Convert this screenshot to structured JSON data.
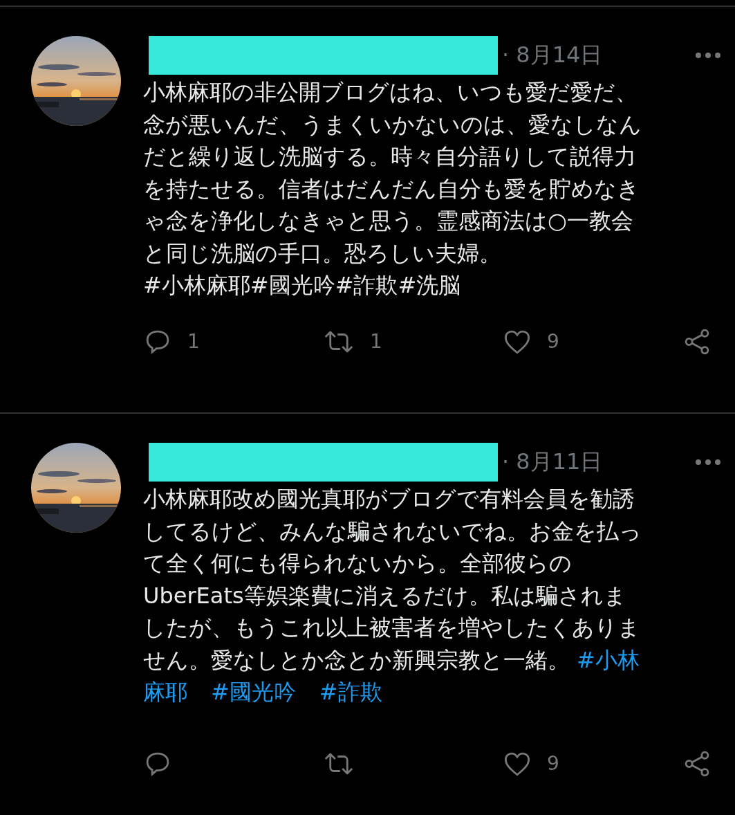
{
  "tweets": [
    {
      "date": "· 8月14日",
      "lines": [
        [
          {
            "kind": "text",
            "text": "小林麻耶の非公開ブログはね、いつも愛だ愛だ、"
          }
        ],
        [
          {
            "kind": "text",
            "text": "念が悪いんだ、うまくいかないのは、愛なしなん"
          }
        ],
        [
          {
            "kind": "text",
            "text": "だと繰り返し洗脳する。時々自分語りして説得力"
          }
        ],
        [
          {
            "kind": "text",
            "text": "を持たせる。信者はだんだん自分も愛を貯めなき"
          }
        ],
        [
          {
            "kind": "text",
            "text": "ゃ念を浄化しなきゃと思う。霊感商法は○一教会"
          }
        ],
        [
          {
            "kind": "text",
            "text": "と同じ洗脳の手口。恐ろしい夫婦。"
          }
        ],
        [
          {
            "kind": "text",
            "text": "#小林麻耶#國光吟#詐欺#洗脳"
          }
        ]
      ],
      "replies": "1",
      "retweets": "1",
      "likes": "9"
    },
    {
      "date": "· 8月11日",
      "lines": [
        [
          {
            "kind": "text",
            "text": "小林麻耶改め國光真耶がブログで有料会員を勧誘"
          }
        ],
        [
          {
            "kind": "text",
            "text": "してるけど、みんな騙されないでね。お金を払っ"
          }
        ],
        [
          {
            "kind": "text",
            "text": "て全く何にも得られないから。全部彼らの"
          }
        ],
        [
          {
            "kind": "text",
            "text": "UberEats等娯楽費に消えるだけ。私は騙されま"
          }
        ],
        [
          {
            "kind": "text",
            "text": "したが、もうこれ以上被害者を増やしたくありま"
          }
        ],
        [
          {
            "kind": "text",
            "text": "せん。愛なしとか念とか新興宗教と一緒。"
          },
          {
            "kind": "hashtag",
            "text": "#小林"
          }
        ],
        [
          {
            "kind": "hashtag",
            "text": "麻耶"
          },
          {
            "kind": "hashtag",
            "text": "#國光吟"
          },
          {
            "kind": "hashtag",
            "text": "#詐欺"
          }
        ]
      ],
      "likes": "9"
    }
  ]
}
